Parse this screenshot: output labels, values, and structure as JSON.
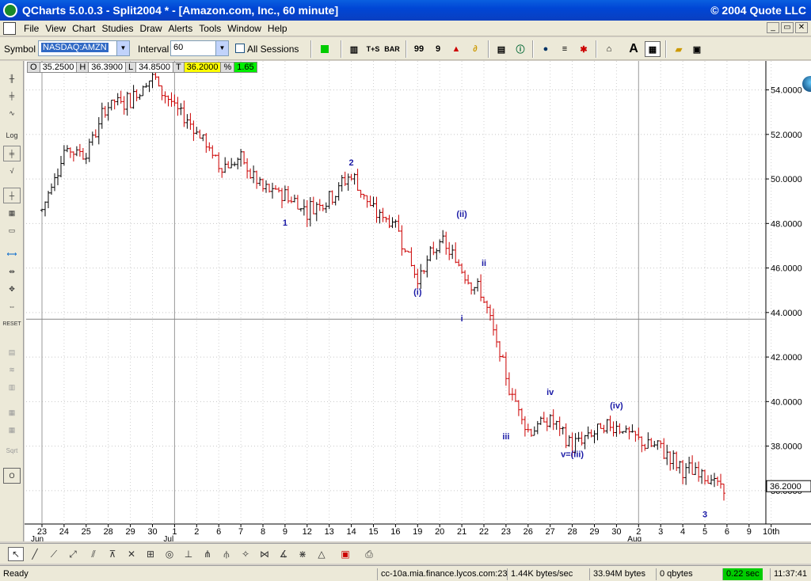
{
  "window": {
    "title": "QCharts 5.0.0.3 - Split2004 * - [Amazon.com, Inc., 60 minute]",
    "copyright": "© 2004 Quote LLC"
  },
  "menu": [
    "File",
    "View",
    "Chart",
    "Studies",
    "Draw",
    "Alerts",
    "Tools",
    "Window",
    "Help"
  ],
  "window_buttons": [
    "_",
    "▭",
    "✕"
  ],
  "toolbar": {
    "symbol_label": "Symbol",
    "symbol_value": "NASDAQ:AMZN",
    "interval_label": "Interval",
    "interval_value": "60",
    "all_sessions_label": "All Sessions",
    "buttons": [
      "T+S",
      "BAR",
      "A"
    ]
  },
  "quote": {
    "open_label": "O",
    "open": "35.2500",
    "high_label": "H",
    "high": "36.3900",
    "low_label": "L",
    "low": "34.8500",
    "close_label": "T",
    "close": "36.2000",
    "change_label": "%",
    "change": "1.65"
  },
  "left_tools": [
    "Log",
    "RESET",
    "Sqrt"
  ],
  "status": {
    "ready": "Ready",
    "server": "cc-10a.mia.finance.lycos.com:23",
    "rate": "1.44K bytes/sec",
    "bytes": "33.94M bytes",
    "qbytes": "0 qbytes",
    "latency": "0.22 sec",
    "time": "11:37:41"
  },
  "colors": {
    "up_bar": "#000000",
    "down_bar": "#cc0000",
    "wave_label": "#1a1aa6",
    "latency_bg": "#00cc00",
    "title_bar": "#0a4fd8"
  },
  "chart_data": {
    "type": "ohlc",
    "symbol": "NASDAQ:AMZN",
    "interval": "60 minute",
    "y_axis": {
      "ticks": [
        "54.0000",
        "52.0000",
        "50.0000",
        "48.0000",
        "46.0000",
        "44.0000",
        "42.0000",
        "40.0000",
        "38.0000",
        "36.0000"
      ],
      "range": [
        34.5,
        55.3
      ],
      "last_price_label": "36.2000"
    },
    "x_axis": {
      "ticks": [
        "23",
        "24",
        "25",
        "28",
        "29",
        "30",
        "1",
        "2",
        "6",
        "7",
        "8",
        "9",
        "12",
        "13",
        "14",
        "15",
        "16",
        "19",
        "20",
        "21",
        "22",
        "23",
        "26",
        "27",
        "28",
        "29",
        "30",
        "2",
        "3",
        "4",
        "5",
        "6",
        "9",
        "10th"
      ],
      "month_labels": [
        "Jun",
        "Jul",
        "Aug"
      ]
    },
    "crosshair_price": 43.7,
    "path_points": [
      [
        "23",
        48.6
      ],
      [
        "24",
        51.3
      ],
      [
        "25",
        51.2
      ],
      [
        "28",
        53.4
      ],
      [
        "29",
        53.6
      ],
      [
        "30",
        54.6
      ],
      [
        "1",
        53.2
      ],
      [
        "2",
        52.2
      ],
      [
        "6",
        50.6
      ],
      [
        "7",
        50.8
      ],
      [
        "8",
        49.5
      ],
      [
        "9",
        49.3
      ],
      [
        "12",
        48.6
      ],
      [
        "13",
        49.2
      ],
      [
        "14",
        50.2
      ],
      [
        "15",
        48.5
      ],
      [
        "16",
        48.0
      ],
      [
        "19",
        45.5
      ],
      [
        "20",
        47.2
      ],
      [
        "21",
        46.0
      ],
      [
        "22",
        44.6
      ],
      [
        "23",
        41.0
      ],
      [
        "26",
        38.7
      ],
      [
        "27",
        39.2
      ],
      [
        "28",
        38.0
      ],
      [
        "29",
        38.6
      ],
      [
        "30",
        39.0
      ],
      [
        "2",
        38.2
      ],
      [
        "3",
        37.9
      ],
      [
        "4",
        36.9
      ],
      [
        "5",
        36.8
      ],
      [
        "6",
        35.8
      ]
    ],
    "wave_labels": [
      {
        "text": "1",
        "day": "9",
        "price": 47.9
      },
      {
        "text": "2",
        "day": "14",
        "price": 50.6
      },
      {
        "text": "(i)",
        "day": "19",
        "price": 44.8
      },
      {
        "text": "(ii)",
        "day": "21",
        "price": 48.3
      },
      {
        "text": "i",
        "day": "21",
        "price": 43.6
      },
      {
        "text": "ii",
        "day": "22",
        "price": 46.1
      },
      {
        "text": "iii",
        "day": "23",
        "price": 38.3
      },
      {
        "text": "iv",
        "day": "27",
        "price": 40.3
      },
      {
        "text": "v=(iii)",
        "day": "28",
        "price": 37.5
      },
      {
        "text": "(iv)",
        "day": "30",
        "price": 39.7
      },
      {
        "text": "3",
        "day": "5",
        "price": 34.8
      }
    ]
  }
}
